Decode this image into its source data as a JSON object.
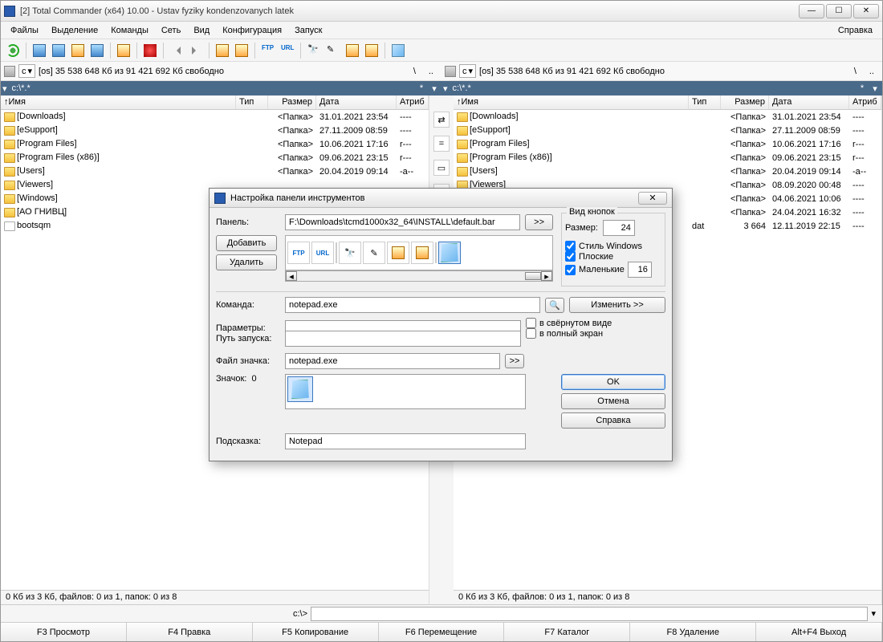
{
  "window": {
    "title": "[2] Total Commander (x64) 10.00 - Ustav fyziky kondenzovanych latek"
  },
  "menu": {
    "files": "Файлы",
    "selection": "Выделение",
    "commands": "Команды",
    "net": "Сеть",
    "view": "Вид",
    "config": "Конфигурация",
    "start": "Запуск",
    "help": "Справка"
  },
  "drive": {
    "letter": "c",
    "info": "[os]  35 538 648 Кб из 91 421 692 Кб свободно",
    "nav_back": "\\",
    "nav_up": ".."
  },
  "tabs": {
    "left": "c:\\*.*",
    "right": "c:\\*.*",
    "star": "*",
    "dd": "▾"
  },
  "cols": {
    "name": "Имя",
    "ext": "Тип",
    "size": "Размер",
    "date": "Дата",
    "attr": "Атриб"
  },
  "sort_indicator": "↑",
  "left_files": [
    {
      "name": "[Downloads]",
      "ext": "",
      "size": "<Папка>",
      "date": "31.01.2021 23:54",
      "attr": "----"
    },
    {
      "name": "[eSupport]",
      "ext": "",
      "size": "<Папка>",
      "date": "27.11.2009 08:59",
      "attr": "----"
    },
    {
      "name": "[Program Files]",
      "ext": "",
      "size": "<Папка>",
      "date": "10.06.2021 17:16",
      "attr": "r---"
    },
    {
      "name": "[Program Files (x86)]",
      "ext": "",
      "size": "<Папка>",
      "date": "09.06.2021 23:15",
      "attr": "r---"
    },
    {
      "name": "[Users]",
      "ext": "",
      "size": "<Папка>",
      "date": "20.04.2019 09:14",
      "attr": "-a--"
    },
    {
      "name": "[Viewers]",
      "ext": "",
      "size": "",
      "date": "",
      "attr": ""
    },
    {
      "name": "[Windows]",
      "ext": "",
      "size": "",
      "date": "",
      "attr": ""
    },
    {
      "name": "[АО ГНИВЦ]",
      "ext": "",
      "size": "",
      "date": "",
      "attr": ""
    },
    {
      "name": "bootsqm",
      "ext": "",
      "size": "",
      "date": "",
      "attr": "",
      "file": true
    }
  ],
  "right_files": [
    {
      "name": "[Downloads]",
      "ext": "",
      "size": "<Папка>",
      "date": "31.01.2021 23:54",
      "attr": "----"
    },
    {
      "name": "[eSupport]",
      "ext": "",
      "size": "<Папка>",
      "date": "27.11.2009 08:59",
      "attr": "----"
    },
    {
      "name": "[Program Files]",
      "ext": "",
      "size": "<Папка>",
      "date": "10.06.2021 17:16",
      "attr": "r---"
    },
    {
      "name": "[Program Files (x86)]",
      "ext": "",
      "size": "<Папка>",
      "date": "09.06.2021 23:15",
      "attr": "r---"
    },
    {
      "name": "[Users]",
      "ext": "",
      "size": "<Папка>",
      "date": "20.04.2019 09:14",
      "attr": "-a--"
    },
    {
      "name": "[Viewers]",
      "ext": "",
      "size": "<Папка>",
      "date": "08.09.2020 00:48",
      "attr": "----"
    },
    {
      "name": "[Windows]",
      "ext": "",
      "size": "<Папка>",
      "date": "04.06.2021 10:06",
      "attr": "----"
    },
    {
      "name": "[АО ГНИВЦ]",
      "ext": "",
      "size": "<Папка>",
      "date": "24.04.2021 16:32",
      "attr": "----"
    },
    {
      "name": "bootsqm",
      "ext": "dat",
      "size": "3 664",
      "date": "12.11.2019 22:15",
      "attr": "----",
      "file": true
    }
  ],
  "status": "0 Кб из 3 Кб, файлов: 0 из 1, папок: 0 из 8",
  "cmd": {
    "prompt": "c:\\>",
    "value": ""
  },
  "fkeys": {
    "f3": "F3 Просмотр",
    "f4": "F4 Правка",
    "f5": "F5 Копирование",
    "f6": "F6 Перемещение",
    "f7": "F7 Каталог",
    "f8": "F8 Удаление",
    "altf4": "Alt+F4 Выход"
  },
  "dialog": {
    "title": "Настройка панели инструментов",
    "panel_lbl": "Панель:",
    "panel_val": "F:\\Downloads\\tcmd1000x32_64\\INSTALL\\default.bar",
    "add": "Добавить",
    "del": "Удалить",
    "browse": ">>",
    "view_group": "Вид кнопок",
    "size_lbl": "Размер:",
    "size_val": "24",
    "style": "Стиль Windows",
    "flat": "Плоские",
    "small": "Маленькие",
    "small_val": "16",
    "command_lbl": "Команда:",
    "command_val": "notepad.exe",
    "change": "Изменить >>",
    "params_lbl": "Параметры:",
    "params_val": "",
    "startpath_lbl": "Путь запуска:",
    "startpath_val": "",
    "minimized": "в свёрнутом виде",
    "fullscreen": "в полный экран",
    "iconfile_lbl": "Файл значка:",
    "iconfile_val": "notepad.exe",
    "icon_lbl": "Значок:",
    "icon_idx": "0",
    "hint_lbl": "Подсказка:",
    "hint_val": "Notepad",
    "ok": "OK",
    "cancel": "Отмена",
    "help": "Справка",
    "search_icon": "🔍"
  }
}
